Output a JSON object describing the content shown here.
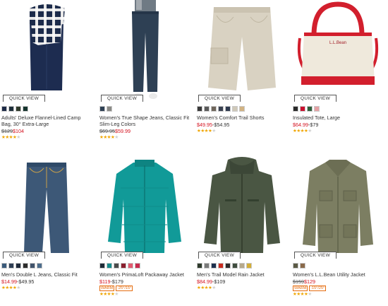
{
  "quick_view_label": "QUICK VIEW",
  "products": [
    {
      "name": "Adults' Deluxe Flannel-Lined Camp Bag, 30° Extra-Large",
      "orig_price": "$129",
      "sale_price": "$104",
      "reg_price": "",
      "badge": "",
      "rating_stars": 4,
      "swatches": [
        "#1d2a46",
        "#1e2f3b",
        "#2f3a2b",
        "#16352e"
      ]
    },
    {
      "name": "Women's True Shape Jeans, Classic Fit Slim-Leg Colors",
      "orig_price": "$69.95",
      "sale_price": "$59.99",
      "reg_price": "",
      "badge": "",
      "rating_stars": 4,
      "swatches": [
        "#2e4054",
        "#8a8a86"
      ]
    },
    {
      "name": "Women's Comfort Trail Shorts",
      "orig_price": "",
      "sale_price": "$49.95",
      "reg_price": "-$54.95",
      "badge": "",
      "rating_stars": 4,
      "swatches": [
        "#3a3a3a",
        "#5a5a5a",
        "#6f665b",
        "#3b4252",
        "#2f3a4f",
        "#cfc8b8",
        "#d2b383"
      ]
    },
    {
      "name": "Insulated Tote, Large",
      "orig_price": "",
      "sale_price": "$64.99",
      "reg_price": "-$79",
      "badge": "",
      "rating_stars": 4,
      "swatches": [
        "#2a2a2a",
        "#c8102e",
        "#2f5e3a",
        "#e5a1a4"
      ]
    },
    {
      "name": "Men's Double L Jeans, Classic Fit",
      "orig_price": "",
      "sale_price": "$14.99",
      "reg_price": "-$49.95",
      "badge": "",
      "rating_stars": 4,
      "swatches": [
        "#3a5a7a",
        "#2e3e54",
        "#1f2a3a",
        "#2c2c2c",
        "#41536b",
        "#4d6d8c"
      ]
    },
    {
      "name": "Women's PrimaLoft Packaway Jacket",
      "orig_price": "",
      "sale_price": "$119",
      "reg_price": "-$179",
      "badge": "WARM",
      "badge2": "-25°/15°",
      "rating_stars": 4,
      "swatches": [
        "#1e2a36",
        "#168c8c",
        "#4a4a4a",
        "#8a1f2e",
        "#e25a6f",
        "#c72a4d"
      ]
    },
    {
      "name": "Men's Trail Model Rain Jacket",
      "orig_price": "",
      "sale_price": "$84.99",
      "reg_price": "-$109",
      "badge": "",
      "rating_stars": 4,
      "swatches": [
        "#2e3a2c",
        "#7a7a7a",
        "#1c2f4d",
        "#c92a1e",
        "#2c2c2c",
        "#3f4d3f",
        "#b7a98b",
        "#d4af37"
      ]
    },
    {
      "name": "Women's L.L.Bean Utility Jacket",
      "orig_price": "$159",
      "sale_price": "$129",
      "reg_price": "",
      "badge": "WARM",
      "badge2": "-15°/25°",
      "rating_stars": 4,
      "swatches": [
        "#5b5a45",
        "#8a6a4a"
      ]
    }
  ]
}
